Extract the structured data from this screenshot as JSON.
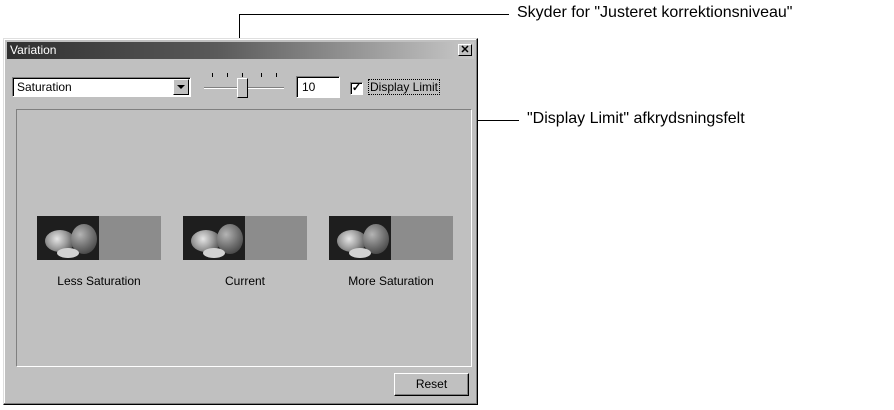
{
  "window": {
    "title": "Variation",
    "close_icon": "close-icon"
  },
  "controls": {
    "adjustment_select_value": "Saturation",
    "correction_level": "10",
    "display_limit_label": "Display Limit",
    "display_limit_checked": true,
    "slider_level": 10
  },
  "variants": [
    {
      "label": "Less Saturation"
    },
    {
      "label": "Current"
    },
    {
      "label": "More Saturation"
    }
  ],
  "reset_label": "Reset",
  "callouts": {
    "slider": "Skyder for \"Justeret korrektionsniveau\"",
    "checkbox": "\"Display Limit\" afkrydsningsfelt"
  }
}
